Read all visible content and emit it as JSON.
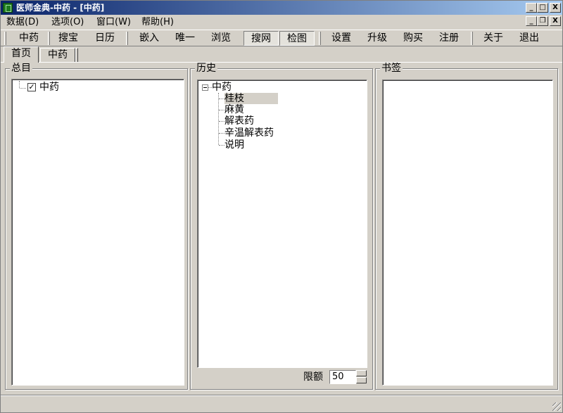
{
  "window": {
    "title": "医师金典-中药 - [中药]"
  },
  "menu": {
    "items": [
      "数据(D)",
      "选项(O)",
      "窗口(W)",
      "帮助(H)"
    ]
  },
  "window_buttons": {
    "minimize": "_",
    "maximize": "□",
    "restore": "❐",
    "close": "X"
  },
  "toolbar": {
    "buttons": [
      "中药",
      "搜宝",
      "日历",
      "嵌入",
      "唯一",
      "浏览",
      "搜网",
      "检图",
      "设置",
      "升级",
      "购买",
      "注册",
      "关于",
      "退出"
    ]
  },
  "tabs": [
    "首页",
    "中药"
  ],
  "panels": {
    "catalog": {
      "title": "总目",
      "root": "中药",
      "root_checkmark": "✓"
    },
    "history": {
      "title": "历史",
      "root": "中药",
      "items": [
        "桂枝",
        "麻黄",
        "解表药",
        "辛温解表药",
        "说明"
      ],
      "limit_label": "限额",
      "limit_value": "50"
    },
    "bookmarks": {
      "title": "书签"
    }
  }
}
